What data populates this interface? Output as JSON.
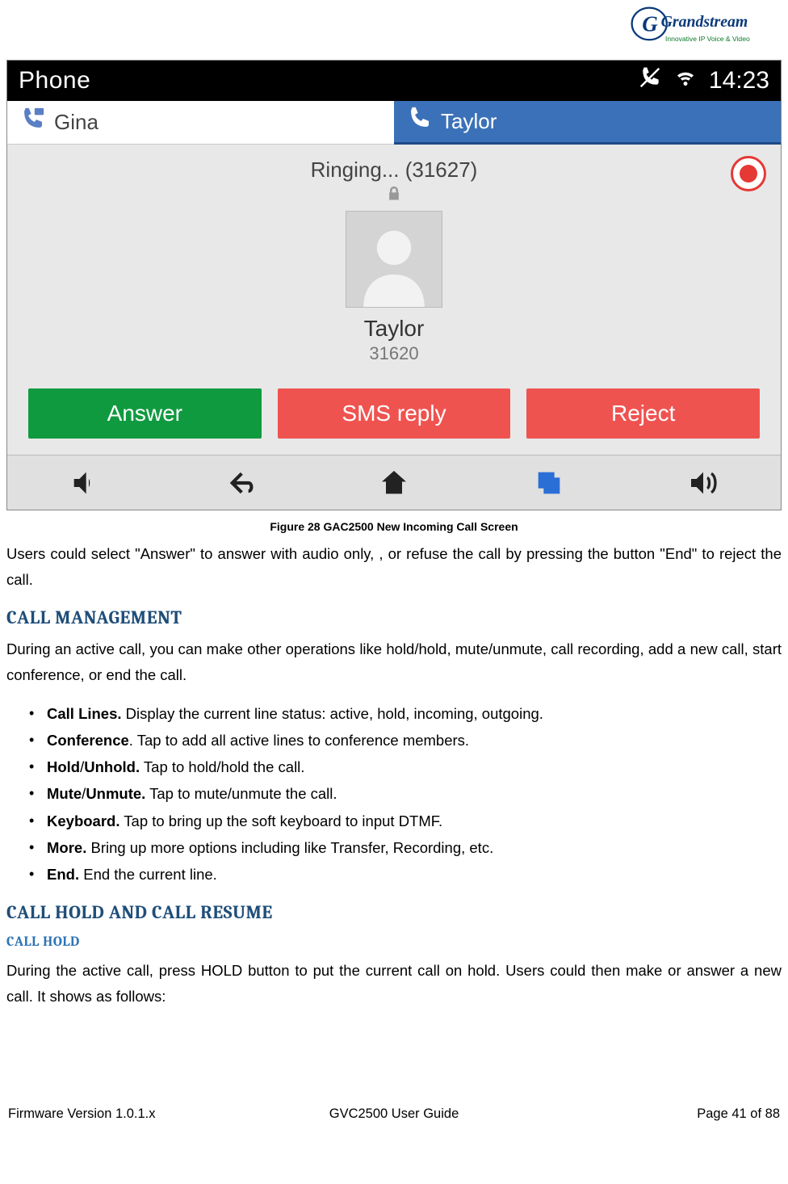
{
  "logo": {
    "brand": "Grandstream",
    "tagline": "Innovative IP Voice & Video"
  },
  "screenshot": {
    "status": {
      "title": "Phone",
      "time": "14:23"
    },
    "tabs": [
      {
        "label": "Gina",
        "active": false
      },
      {
        "label": "Taylor",
        "active": true
      }
    ],
    "ringing_text": "Ringing... (31627)",
    "caller": {
      "name": "Taylor",
      "number": "31620"
    },
    "buttons": {
      "answer": "Answer",
      "sms": "SMS reply",
      "reject": "Reject"
    }
  },
  "caption": "Figure 28 GAC2500 New Incoming Call Screen",
  "para1": "Users could select \"Answer\" to answer with audio only, , or refuse the call by pressing the button \"End\" to reject the call.",
  "sec1_title": "CALL MANAGEMENT",
  "sec1_para": "During an active call, you can make other operations like hold/hold, mute/unmute, call recording, add a new call, start conference, or end the call.",
  "features": [
    {
      "b": "Call Lines.",
      "t": " Display the current line status: active, hold, incoming, outgoing."
    },
    {
      "b": "Conference",
      "t": ". Tap to add all active lines to conference members."
    },
    {
      "b": "Hold",
      "m": "/",
      "b2": "Unhold.",
      "t": " Tap to hold/hold the call."
    },
    {
      "b": "Mute",
      "m": "/",
      "b2": "Unmute.",
      "t": " Tap to mute/unmute the call."
    },
    {
      "b": "Keyboard.",
      "t": " Tap to bring up the soft keyboard to input DTMF."
    },
    {
      "b": "More.",
      "t": " Bring up more options including like Transfer, Recording, etc."
    },
    {
      "b": "End.",
      "t": " End the current line."
    }
  ],
  "sec2_title": "CALL HOLD AND CALL RESUME",
  "sub1_title": "CALL HOLD",
  "sub1_para": "During the active call, press HOLD button to put the current call on hold. Users could then make or answer a new call. It shows as follows:",
  "footer": {
    "left": "Firmware Version 1.0.1.x",
    "center": "GVC2500 User Guide",
    "right": "Page 41 of 88"
  }
}
